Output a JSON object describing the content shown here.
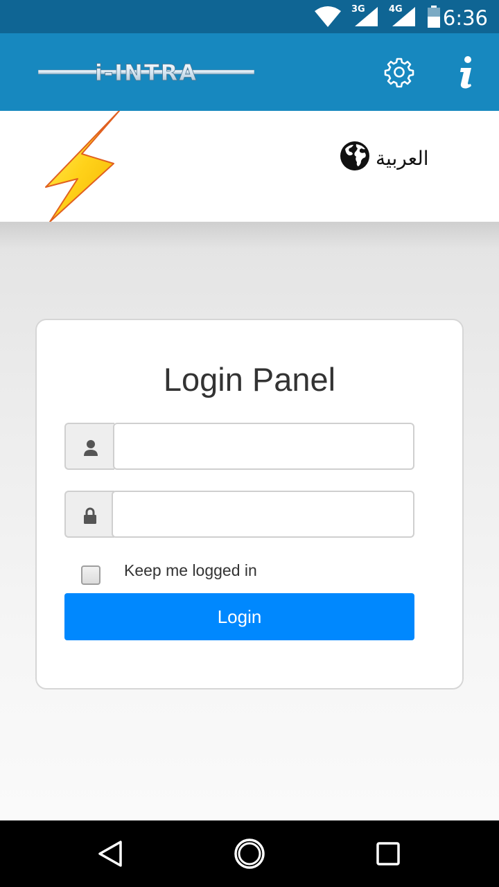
{
  "status_bar": {
    "time": "6:36",
    "network_1": "3G",
    "network_2": "4G",
    "icons": [
      "wifi-icon",
      "signal-3g-icon",
      "signal-4g-icon",
      "battery-icon"
    ]
  },
  "app_bar": {
    "logo_text": "i-INTRA",
    "settings_icon": "gear-icon",
    "info_icon": "info-icon",
    "background": "#1788bf"
  },
  "brand": {
    "logo_icon": "lightning-bolt-icon",
    "language_label": "العربية",
    "language_icon": "globe-icon"
  },
  "login": {
    "title": "Login Panel",
    "username": {
      "value": "",
      "placeholder": "",
      "icon": "user-icon"
    },
    "password": {
      "value": "",
      "placeholder": "",
      "icon": "lock-icon"
    },
    "remember_label": "Keep me logged in",
    "remember_checked": false,
    "button_label": "Login",
    "button_color": "#0088fe"
  },
  "nav_bar": {
    "icons": [
      "back-icon",
      "home-icon",
      "recents-icon"
    ]
  }
}
